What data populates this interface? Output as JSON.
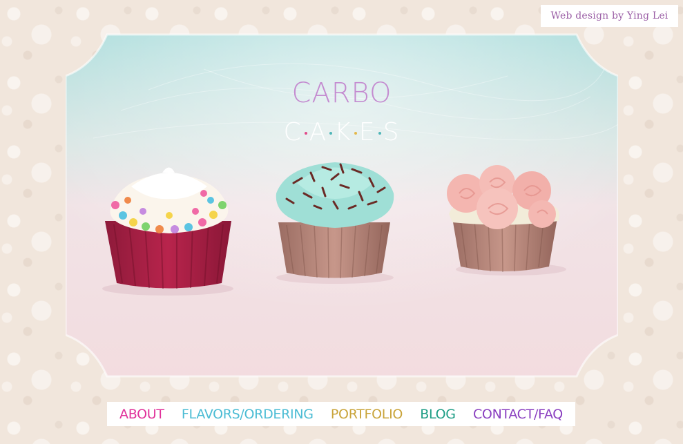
{
  "credit": {
    "text": "Web design by Ying Lei"
  },
  "brand": {
    "top": "CARBO",
    "bottom_letters": [
      "C",
      "A",
      "K",
      "E",
      "S"
    ],
    "dot_colors": [
      "#e14b8a",
      "#4fb6b8",
      "#e4b84a",
      "#4fb6b8"
    ]
  },
  "nav": {
    "items": [
      {
        "label": "ABOUT",
        "color": "#e0309a"
      },
      {
        "label": "FLAVORS/ORDERING",
        "color": "#4bbcd4"
      },
      {
        "label": "PORTFOLIO",
        "color": "#c9a43a"
      },
      {
        "label": "BLOG",
        "color": "#1f9e86"
      },
      {
        "label": "CONTACT/FAQ",
        "color": "#8a3fc0"
      }
    ]
  },
  "cupcakes": [
    {
      "frosting": "white-with-candy-dots",
      "wrapper": "red"
    },
    {
      "frosting": "mint-with-chocolate-sprinkles",
      "wrapper": "brown"
    },
    {
      "frosting": "pink-roses",
      "wrapper": "brown"
    }
  ],
  "colors": {
    "lace_bg": "#f1e6dc",
    "frame_sky": "#a9dcdb",
    "frame_floor": "#f3dcdf"
  }
}
